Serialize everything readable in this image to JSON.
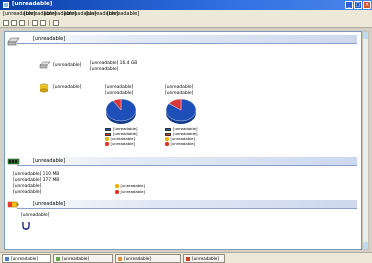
{
  "window": {
    "title": "[unreadable]",
    "min": "_",
    "max": "□",
    "close": "×"
  },
  "menu": [
    "[unreadable]",
    "[unreadable]",
    "[unreadable]",
    "[unreadable]",
    "[unreadable]",
    "[unreadable]"
  ],
  "sections": {
    "hard_disk": "[unreadable]",
    "memory": "[unreadable]",
    "power": "[unreadable]"
  },
  "disk": {
    "physical_label": "[unreadable]",
    "physical_lines": [
      "[unreadable] 16.4 GB",
      "[unreadable]"
    ],
    "logical_label": "[unreadable]",
    "drives": [
      {
        "name": "[unreadable]",
        "fs": "[unreadable]",
        "used_pct": 91,
        "free_pct": 9,
        "legend": [
          "[unreadable]",
          "[unreadable]",
          "[unreadable]",
          "[unreadable]"
        ]
      },
      {
        "name": "[unreadable]",
        "fs": "[unreadable]",
        "used_pct": 85,
        "free_pct": 15,
        "legend": [
          "[unreadable]",
          "[unreadable]",
          "[unreadable]",
          "[unreadable]"
        ]
      }
    ]
  },
  "memory": {
    "lines": [
      "[unreadable] 110 MB",
      "[unreadable] 377 MB",
      "[unreadable]",
      "[unreadable]"
    ],
    "status": [
      "[unreadable]",
      "[unreadable]"
    ]
  },
  "power": {
    "line": "[unreadable]"
  },
  "tabs": [
    "[unreadable]",
    "[unreadable]",
    "[unreadable]",
    "[unreadable]"
  ],
  "colors": {
    "used": "#1e4fb8",
    "free": "#d8383a",
    "pie_edge": "#ffffff",
    "ok_dot": "#e0b400",
    "warn_dot": "#e03020",
    "title": "#1a4fc8"
  }
}
